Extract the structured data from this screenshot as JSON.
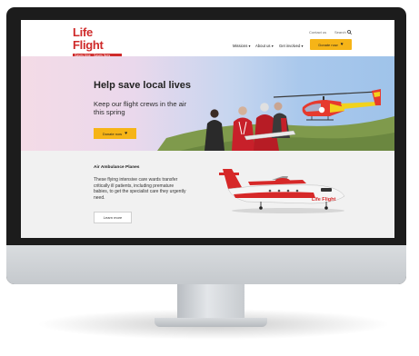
{
  "header": {
    "logo_title": "Life Flight",
    "logo_tagline": "Saves time · Saves lives",
    "contact_label": "Contact us",
    "search_label": "Search",
    "nav": [
      "Missions",
      "About us",
      "Get involved"
    ],
    "donate_label": "Donate now"
  },
  "hero": {
    "title": "Help save local lives",
    "subtitle": "Keep our flight crews in the air this spring",
    "button_label": "Donate now"
  },
  "section": {
    "title": "Air Ambulance Planes",
    "body": "These flying intensive care wards transfer critically ill patients, including premature babies, to get the specialist care they urgently need.",
    "button_label": "Learn more"
  },
  "plane_livery": "Life Flight",
  "colors": {
    "brand_red": "#cf2a2a",
    "donate_yellow": "#f6b417",
    "monitor_bezel": "#1c1c1c"
  },
  "icons": [
    "search-icon",
    "chevron-down-icon",
    "heart-icon"
  ]
}
